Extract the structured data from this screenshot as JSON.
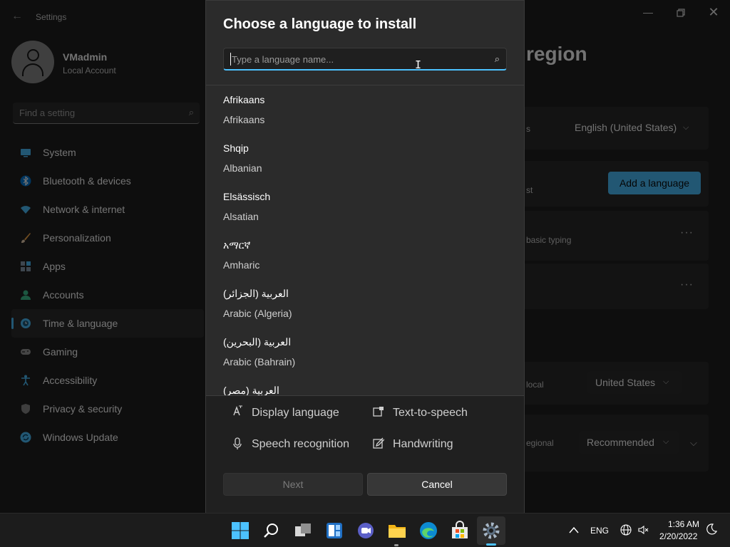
{
  "settings": {
    "app_title": "Settings",
    "user": {
      "name": "VMadmin",
      "type": "Local Account"
    },
    "search_placeholder": "Find a setting",
    "nav": [
      {
        "label": "System",
        "icon": "system-icon",
        "color": "#4cc2ff"
      },
      {
        "label": "Bluetooth & devices",
        "icon": "bluetooth-icon",
        "color": "#0078d4"
      },
      {
        "label": "Network & internet",
        "icon": "wifi-icon",
        "color": "#4cc2ff"
      },
      {
        "label": "Personalization",
        "icon": "brush-icon",
        "color": "#f7a94b"
      },
      {
        "label": "Apps",
        "icon": "apps-icon",
        "color": "#8a9bb0"
      },
      {
        "label": "Accounts",
        "icon": "accounts-icon",
        "color": "#3ec28f"
      },
      {
        "label": "Time & language",
        "icon": "globe-clock-icon",
        "color": "#4cc2ff"
      },
      {
        "label": "Gaming",
        "icon": "gamepad-icon",
        "color": "#9a9a9a"
      },
      {
        "label": "Accessibility",
        "icon": "accessibility-icon",
        "color": "#4cc2ff"
      },
      {
        "label": "Privacy & security",
        "icon": "shield-icon",
        "color": "#8a8a8a"
      },
      {
        "label": "Windows Update",
        "icon": "update-icon",
        "color": "#4cc2ff"
      }
    ],
    "active_nav": "Time & language",
    "page_heading_fragment": "region",
    "display_lang_frag": "s",
    "display_lang_value": "English (United States)",
    "preferred_frag": "st",
    "add_language_label": "Add a language",
    "basic_typing_frag": "basic typing",
    "country_frag": "local",
    "country_value": "United States",
    "regional_frag": "egional",
    "regional_value": "Recommended"
  },
  "dialog": {
    "title": "Choose a language to install",
    "search_placeholder": "Type a language name...",
    "languages": [
      {
        "native": "Afrikaans",
        "english": "Afrikaans"
      },
      {
        "native": "Shqip",
        "english": "Albanian"
      },
      {
        "native": "Elsässisch",
        "english": "Alsatian"
      },
      {
        "native": "አማርኛ",
        "english": "Amharic"
      },
      {
        "native": "العربية (الجزائر)",
        "english": "Arabic (Algeria)"
      },
      {
        "native": "العربية (البحرين)",
        "english": "Arabic (Bahrain)"
      },
      {
        "native": "العربية (مصر)",
        "english": ""
      }
    ],
    "features": {
      "display_language": "Display language",
      "text_to_speech": "Text-to-speech",
      "speech_recognition": "Speech recognition",
      "handwriting": "Handwriting"
    },
    "next_label": "Next",
    "cancel_label": "Cancel"
  },
  "taskbar": {
    "apps": [
      "start-icon",
      "search-icon",
      "task-view-icon",
      "widgets-icon",
      "chat-icon",
      "file-explorer-icon",
      "edge-icon",
      "store-icon",
      "settings-icon"
    ],
    "lang_indicator": "ENG",
    "time": "1:36 AM",
    "date": "2/20/2022"
  }
}
